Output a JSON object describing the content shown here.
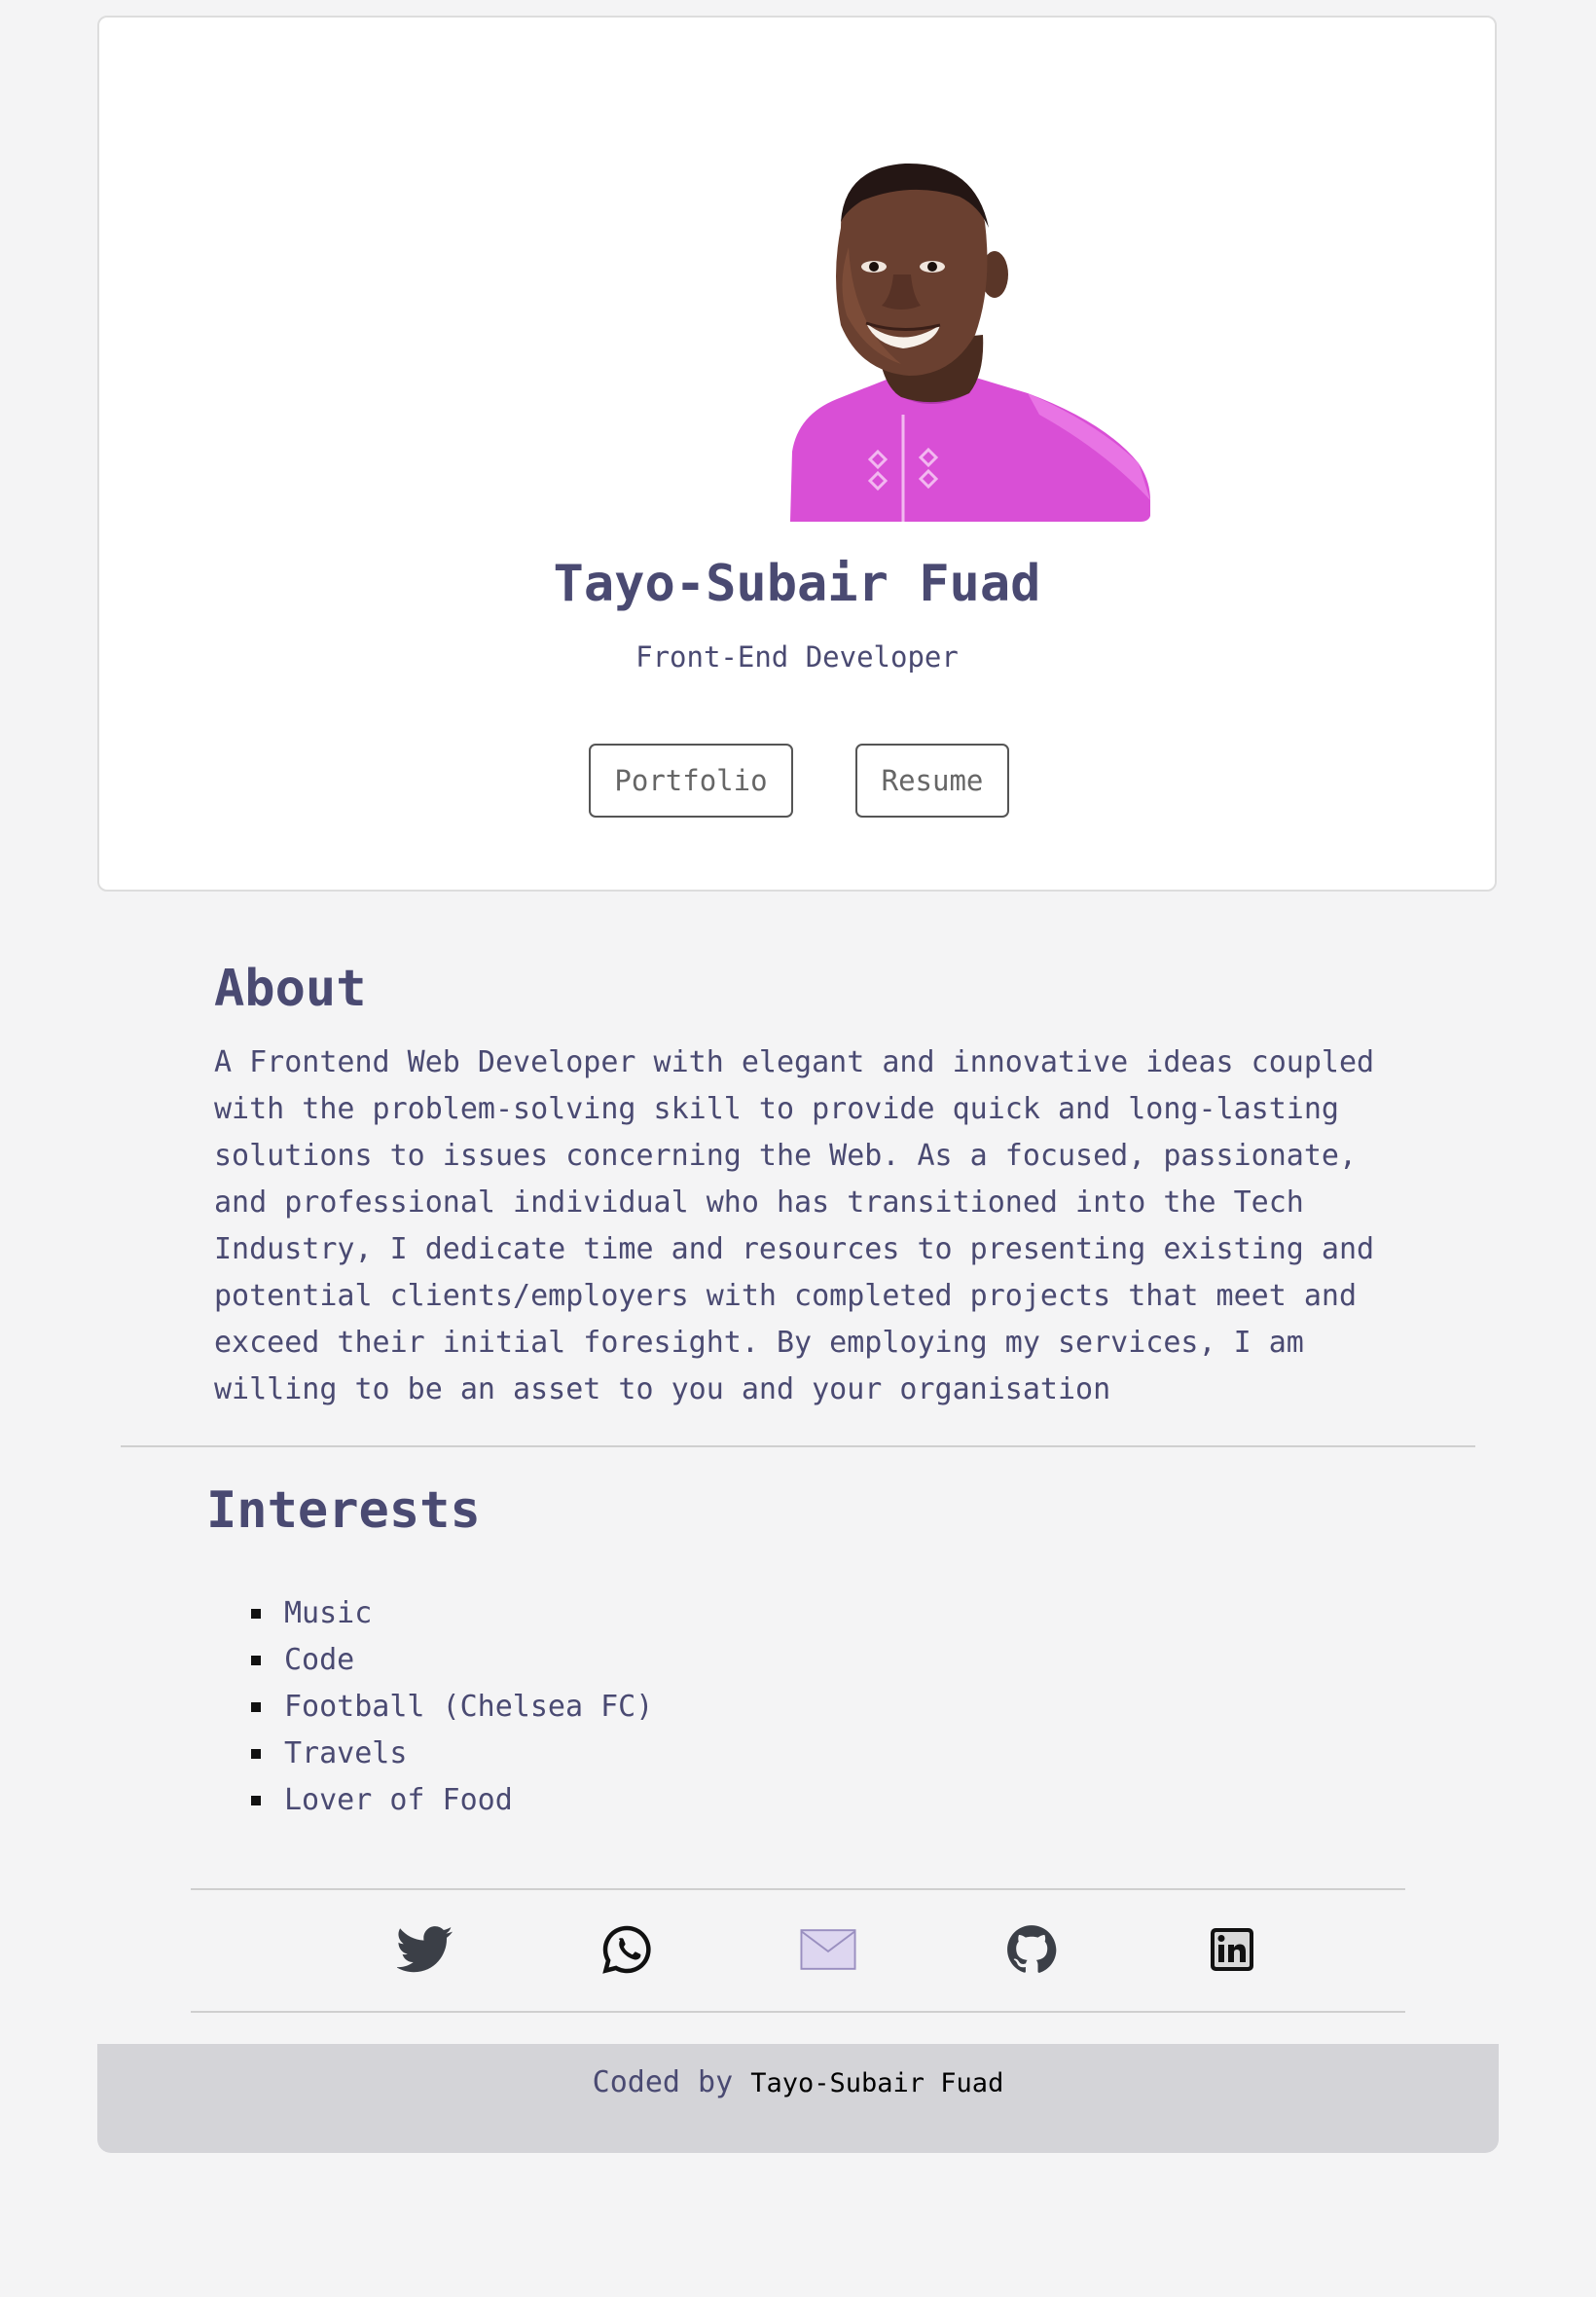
{
  "profile": {
    "name": "Tayo-Subair Fuad",
    "title": "Front-End Developer",
    "photo": "profile-photo"
  },
  "buttons": {
    "portfolio": "Portfolio",
    "resume": "Resume"
  },
  "about": {
    "heading": "About",
    "text": "A Frontend Web Developer with elegant and innovative ideas coupled with the problem-solving skill to provide quick and long-lasting solutions to issues concerning the Web. As a focused, passionate, and professional individual who has transitioned into the Tech Industry, I dedicate time and resources to presenting existing and potential clients/employers with completed projects that meet and exceed their initial foresight. By employing my services, I am willing to be an asset to you and your organisation"
  },
  "interests": {
    "heading": "Interests",
    "items": [
      "Music",
      "Code",
      "Football (Chelsea FC)",
      "Travels",
      "Lover of Food"
    ]
  },
  "social": {
    "icons": [
      "twitter-icon",
      "whatsapp-icon",
      "mail-icon",
      "github-icon",
      "linkedin-icon"
    ]
  },
  "footer": {
    "prefix": "Coded by",
    "author": "Tayo-Subair Fuad"
  },
  "colors": {
    "page_bg": "#f4f4f5",
    "card_bg": "#ffffff",
    "heading_text": "#4a4a72",
    "footer_bg": "#d4d4d8",
    "shirt": "#d94fd6",
    "mail_fill": "#ddd6f0"
  }
}
